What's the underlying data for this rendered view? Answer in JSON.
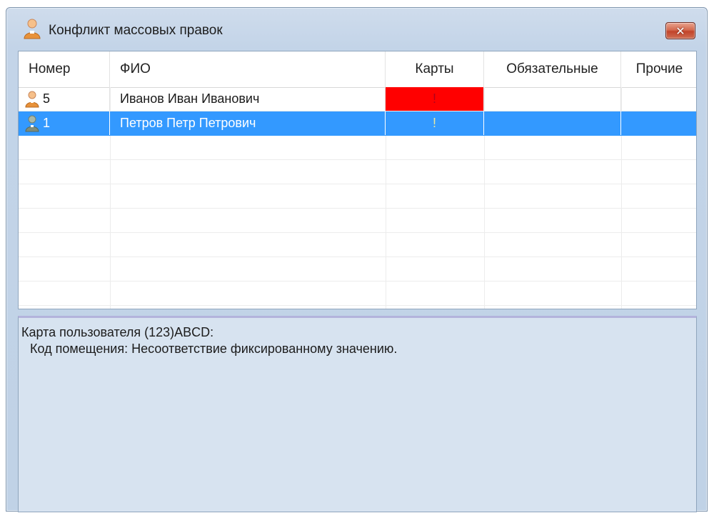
{
  "window": {
    "title": "Конфликт массовых правок",
    "title_icon": "user-icon",
    "close_icon": "close-icon",
    "close_label": "✕"
  },
  "grid": {
    "columns": [
      "Номер",
      "ФИО",
      "Карты",
      "Обязательные",
      "Прочие"
    ],
    "rows": [
      {
        "icon": "user-orange-icon",
        "number": "5",
        "name": "Иванов Иван Иванович",
        "cards": "!",
        "required": "",
        "other": "",
        "selected": false
      },
      {
        "icon": "user-gray-icon",
        "number": "1",
        "name": "Петров Петр Петрович",
        "cards": "!",
        "required": "",
        "other": "",
        "selected": true
      }
    ],
    "colors": {
      "selection": "#3399ff",
      "conflict": "#ff0000"
    }
  },
  "details": {
    "line1": "Карта пользователя (123)ABCD:",
    "line2": "Код помещения: Несоответствие фиксированному значению."
  }
}
